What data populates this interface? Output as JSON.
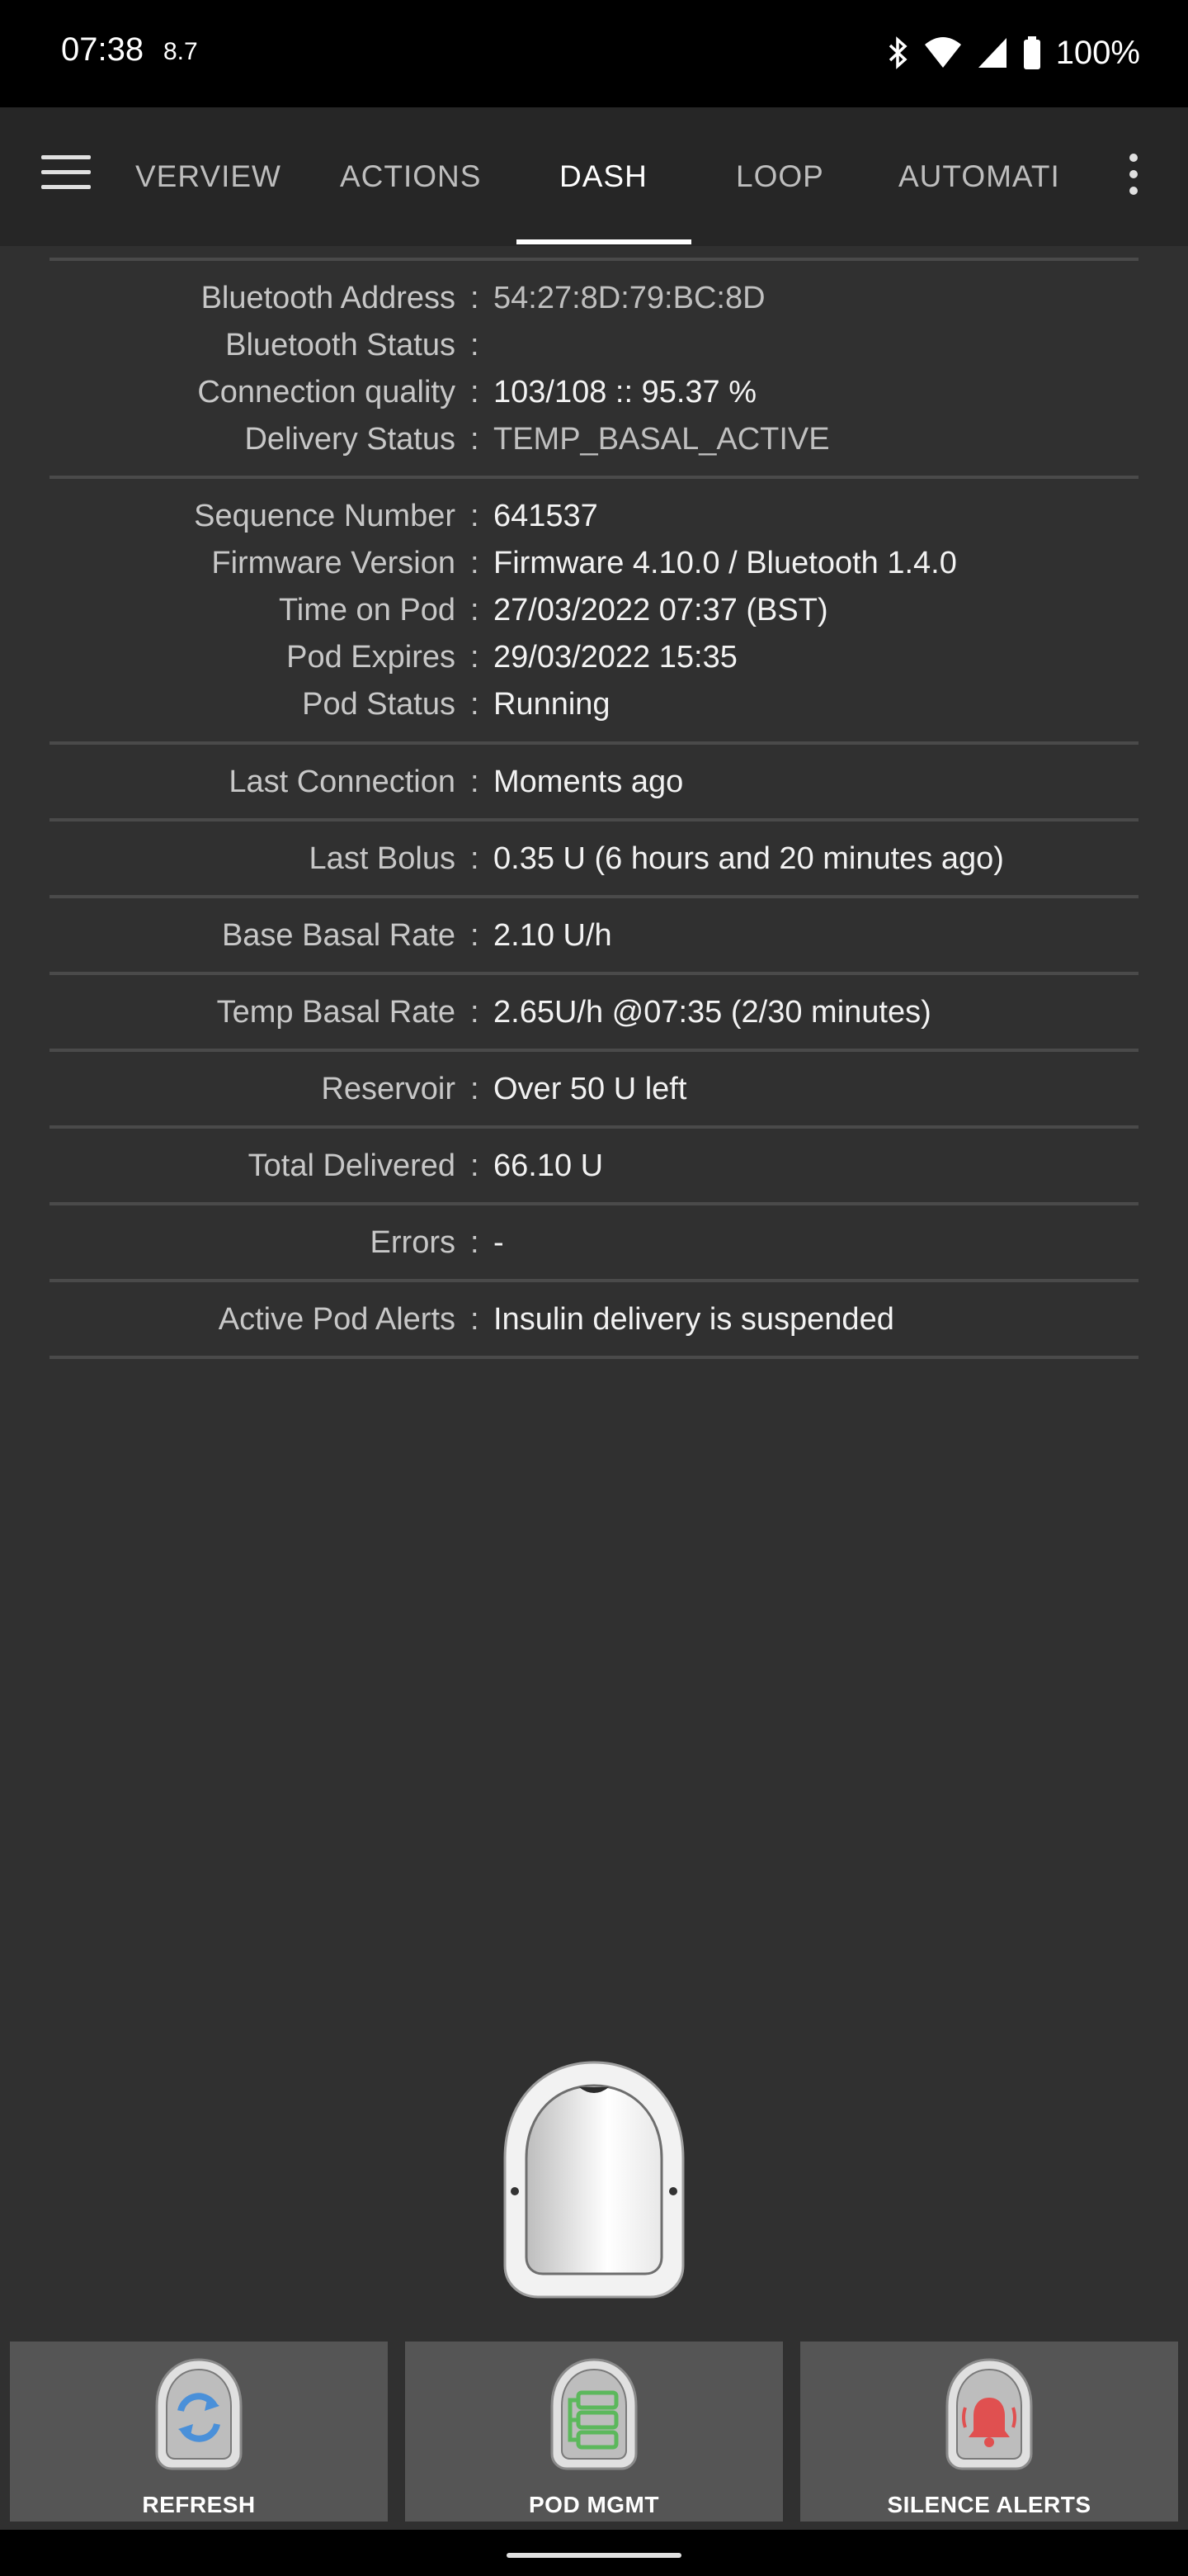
{
  "status_bar": {
    "time": "07:38",
    "extra": "8.7",
    "battery_pct": "100%",
    "icons": [
      "bluetooth-icon",
      "wifi-icon",
      "cell-signal-icon",
      "battery-icon"
    ]
  },
  "tabs": [
    {
      "label": "VERVIEW",
      "active": false
    },
    {
      "label": "ACTIONS",
      "active": false
    },
    {
      "label": "DASH",
      "active": true
    },
    {
      "label": "LOOP",
      "active": false
    },
    {
      "label": "AUTOMATI",
      "active": false
    }
  ],
  "fields": [
    {
      "label": "Bluetooth Address",
      "value": "54:27:8D:79:BC:8D"
    },
    {
      "label": "Bluetooth Status",
      "value": ""
    },
    {
      "label": "Connection quality",
      "value": "103/108 :: 95.37 %"
    },
    {
      "label": "Delivery Status",
      "value": "TEMP_BASAL_ACTIVE"
    },
    {
      "label": "Sequence Number",
      "value": "641537"
    },
    {
      "label": "Firmware Version",
      "value": "Firmware 4.10.0 / Bluetooth 1.4.0"
    },
    {
      "label": "Time on Pod",
      "value": "27/03/2022 07:37 (BST)"
    },
    {
      "label": "Pod Expires",
      "value": "29/03/2022 15:35"
    },
    {
      "label": "Pod Status",
      "value": "Running"
    },
    {
      "label": "Last Connection",
      "value": "Moments ago"
    },
    {
      "label": "Last Bolus",
      "value": "0.35 U (6 hours and 20 minutes ago)"
    },
    {
      "label": "Base Basal Rate",
      "value": "2.10 U/h"
    },
    {
      "label": "Temp Basal Rate",
      "value": "2.65U/h @07:35 (2/30 minutes)"
    },
    {
      "label": "Reservoir",
      "value": "Over 50 U left"
    },
    {
      "label": "Total Delivered",
      "value": "66.10 U"
    },
    {
      "label": "Errors",
      "value": "-"
    },
    {
      "label": "Active Pod Alerts",
      "value": "Insulin delivery is suspended"
    }
  ],
  "colon": ":",
  "buttons": [
    {
      "label": "REFRESH",
      "icon": "refresh-icon",
      "color": "#4a90d9"
    },
    {
      "label": "POD MGMT",
      "icon": "pod-management-icon",
      "color": "#5cb85c"
    },
    {
      "label": "SILENCE ALERTS",
      "icon": "alarm-bell-icon",
      "color": "#e05050"
    }
  ]
}
